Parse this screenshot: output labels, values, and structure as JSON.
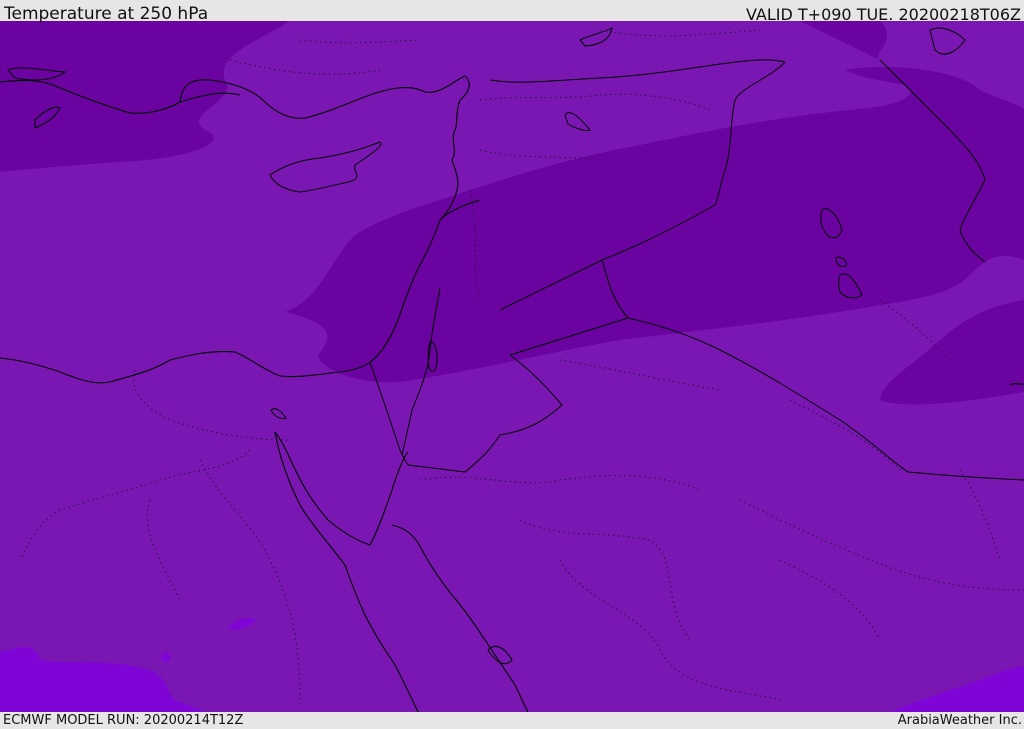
{
  "header": {
    "title": "Temperature at 250 hPa",
    "valid_time": "VALID T+090 TUE. 20200218T06Z"
  },
  "footer": {
    "model_run": "ECMWF MODEL RUN: 20200214T12Z",
    "credit": "ArabiaWeather Inc."
  },
  "map": {
    "field": "temperature-250hpa",
    "colors": {
      "base": "#7a17b2",
      "cold_band": "#6a039f",
      "warm_patch": "#7f04d6",
      "coastline": "#000000",
      "border": "#000000"
    }
  }
}
